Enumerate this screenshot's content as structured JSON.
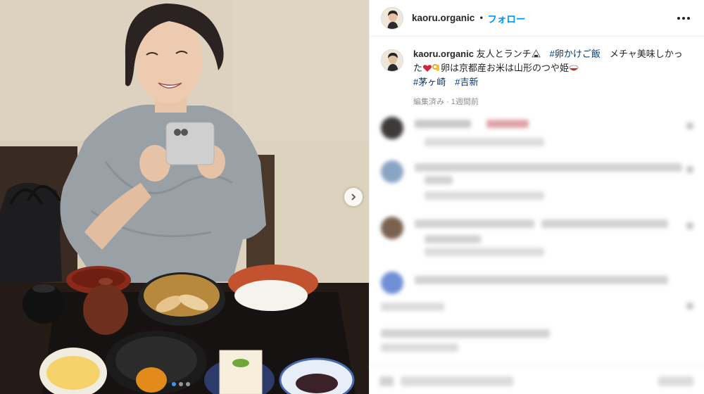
{
  "header": {
    "username": "kaoru.organic",
    "separator": "•",
    "follow_label": "フォロー"
  },
  "caption": {
    "username": "kaoru.organic",
    "text1": " 友人とランチ",
    "tag1": "#卵かけご飯",
    "text2": "　メチャ美味しかった",
    "text3": "卵は京都産お米は山形のつや姫",
    "tag2": "#茅ヶ崎",
    "tag3": "#吉新",
    "meta": "編集済み · 1週間前"
  },
  "carousel": {
    "active_index": 0,
    "count": 3
  },
  "icons": {
    "more": "more-horizontal-icon",
    "next": "chevron-right-icon",
    "rice_ball": "onigiri-icon",
    "heart": "heart-icon",
    "ok_hand": "ok-hand-icon",
    "rice_bowl": "rice-bowl-icon"
  },
  "colors": {
    "link": "#0095f6",
    "hashtag": "#00376b",
    "meta": "#8e8e8e",
    "text": "#262626"
  }
}
